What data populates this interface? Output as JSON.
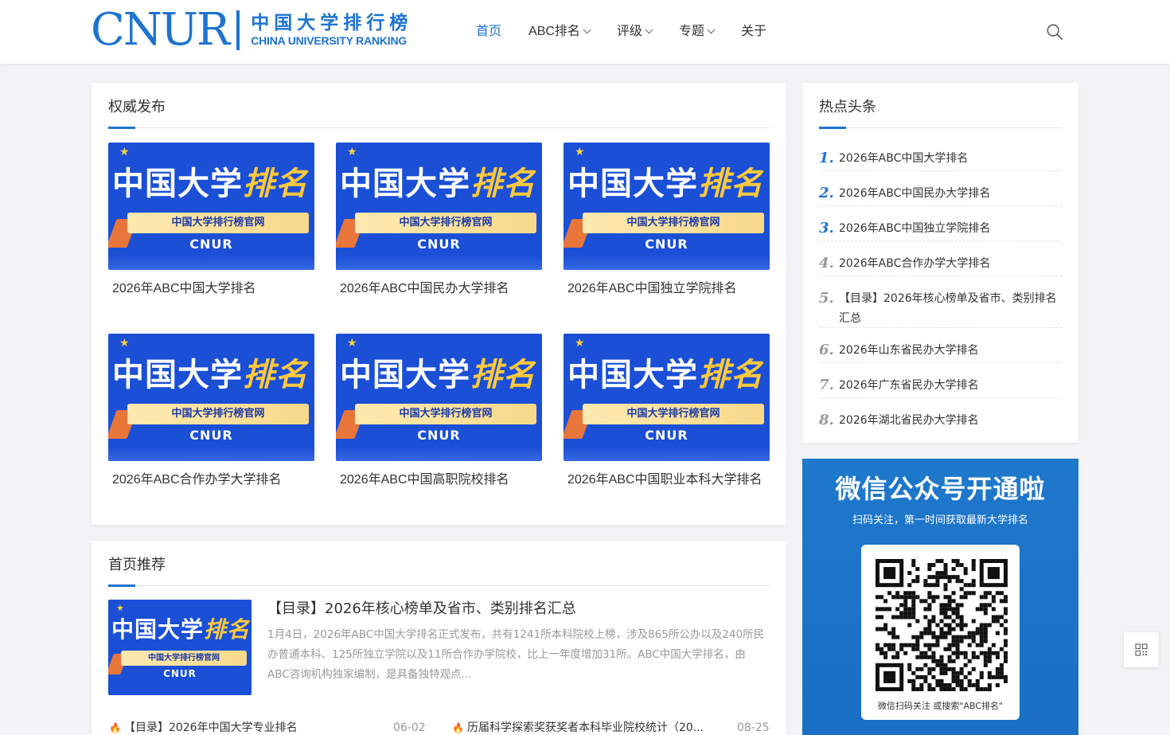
{
  "logo": {
    "text": "CNUR",
    "cn": "中国大学排行榜",
    "en": "CHINA UNIVERSITY RANKING"
  },
  "nav": [
    {
      "label": "首页",
      "active": true,
      "dropdown": false
    },
    {
      "label": "ABC排名",
      "active": false,
      "dropdown": true
    },
    {
      "label": "评级",
      "active": false,
      "dropdown": true
    },
    {
      "label": "专题",
      "active": false,
      "dropdown": true
    },
    {
      "label": "关于",
      "active": false,
      "dropdown": false
    }
  ],
  "thumb": {
    "main": "中国大学",
    "main_accent": "排名",
    "ribbon": "中国大学排行榜官网",
    "brand": "CNUR"
  },
  "authority": {
    "title": "权威发布",
    "items": [
      "2026年ABC中国大学排名",
      "2026年ABC中国民办大学排名",
      "2026年ABC中国独立学院排名",
      "2026年ABC合作办学大学排名",
      "2026年ABC中国高职院校排名",
      "2026年ABC中国职业本科大学排名"
    ]
  },
  "hot": {
    "title": "热点头条",
    "items": [
      {
        "num": "1.",
        "text": "2026年ABC中国大学排名"
      },
      {
        "num": "2.",
        "text": "2026年ABC中国民办大学排名"
      },
      {
        "num": "3.",
        "text": "2026年ABC中国独立学院排名"
      },
      {
        "num": "4.",
        "text": "2026年ABC合作办学大学排名"
      },
      {
        "num": "5.",
        "text": "【目录】2026年核心榜单及省市、类别排名汇总"
      },
      {
        "num": "6.",
        "text": "2026年山东省民办大学排名"
      },
      {
        "num": "7.",
        "text": "2026年广东省民办大学排名"
      },
      {
        "num": "8.",
        "text": "2026年湖北省民办大学排名"
      }
    ]
  },
  "wechat": {
    "title": "微信公众号开通啦",
    "subtitle": "扫码关注，第一时间获取最新大学排名",
    "caption": "微信扫码关注 或搜索\"ABC排名\""
  },
  "recommend": {
    "title": "首页推荐",
    "featured_title": "【目录】2026年核心榜单及省市、类别排名汇总",
    "featured_desc": "1月4日，2026年ABC中国大学排名正式发布，共有1241所本科院校上榜，涉及865所公办以及240所民办普通本科、125所独立学院以及11所合作办学院校，比上一年度增加31所。ABC中国大学排名，由ABC咨询机构独家编制，是具备独特观点...",
    "news": [
      {
        "text": "【目录】2026年中国大学专业排名",
        "date": "06-02"
      },
      {
        "text": "历届科学探索奖获奖者本科毕业院校统计（20...",
        "date": "08-25"
      }
    ]
  }
}
